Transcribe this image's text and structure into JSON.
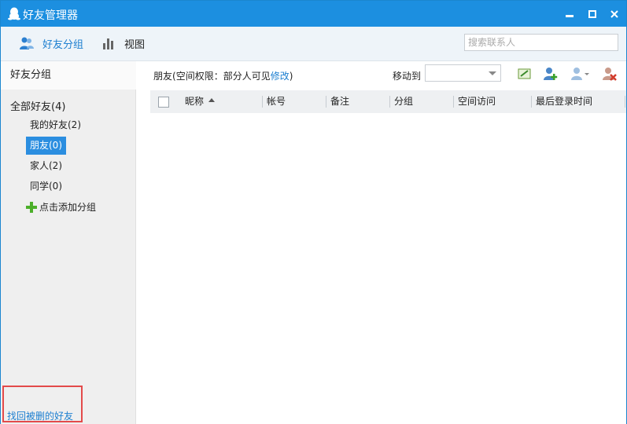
{
  "window": {
    "title": "好友管理器",
    "accent": "#1c8fe0",
    "minimize_glyph": "▬",
    "maximize_glyph": "■",
    "close_glyph": "✕"
  },
  "toolbar": {
    "groups_label": "好友分组",
    "groups_icon": "friends-icon",
    "view_label": "视图",
    "view_icon": "bar-chart-icon",
    "search_placeholder": "搜索联系人"
  },
  "sidebar": {
    "header": "好友分组",
    "all_friends": "全部好友(4)",
    "items": [
      {
        "label": "我的好友(2)",
        "active": false
      },
      {
        "label": "朋友(0)",
        "active": true
      },
      {
        "label": "家人(2)",
        "active": false
      },
      {
        "label": "同学(0)",
        "active": false
      }
    ],
    "add_group_label": "点击添加分组",
    "recover_label": "找回被删的好友"
  },
  "main": {
    "group_name": "朋友",
    "perm_text": "(空间权限：部分人可见",
    "perm_edit": "修改",
    "perm_close": ")",
    "moveto_label": "移动到",
    "moveto_value": "",
    "actions": [
      "edit-note-icon",
      "add-friend-icon",
      "manage-dropdown-icon",
      "delete-friend-icon"
    ],
    "columns": [
      "昵称",
      "帐号",
      "备注",
      "分组",
      "空间访问",
      "最后登录时间"
    ],
    "rows": []
  }
}
